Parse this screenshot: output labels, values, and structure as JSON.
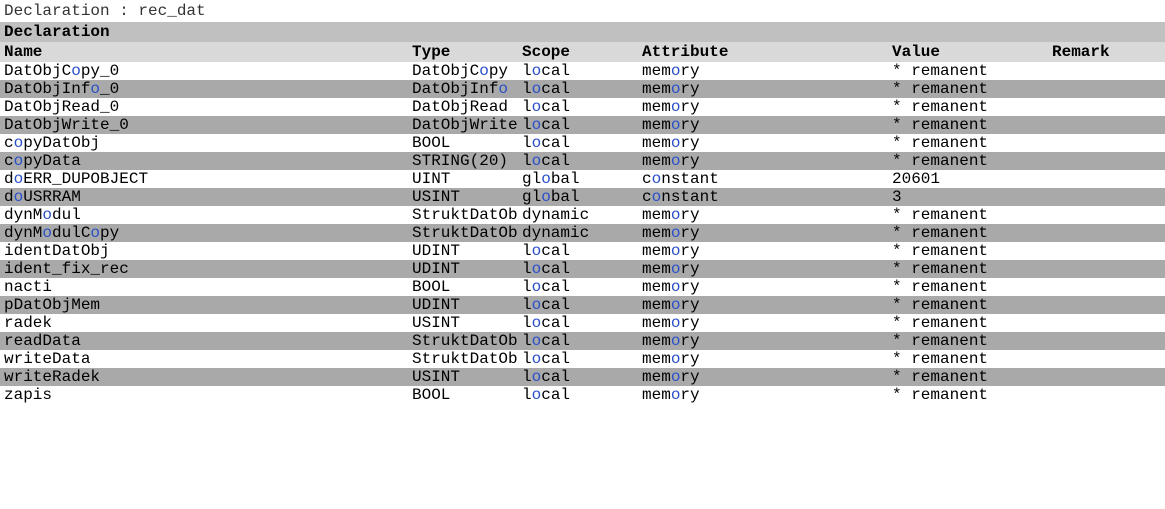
{
  "title_prefix": "Declaration : ",
  "title_name": "rec_dat",
  "section_title": "Declaration",
  "columns": {
    "name": "Name",
    "type": "Type",
    "scope": "Scope",
    "attribute": "Attribute",
    "value": "Value",
    "remark": "Remark"
  },
  "rows": [
    {
      "name": "DatObjCopy_0",
      "type": "DatObjCopy",
      "scope": "local",
      "attribute": "memory",
      "value": "* remanent",
      "remark": ""
    },
    {
      "name": "DatObjInfo_0",
      "type": "DatObjInfo",
      "scope": "local",
      "attribute": "memory",
      "value": "* remanent",
      "remark": ""
    },
    {
      "name": "DatObjRead_0",
      "type": "DatObjRead",
      "scope": "local",
      "attribute": "memory",
      "value": "* remanent",
      "remark": ""
    },
    {
      "name": "DatObjWrite_0",
      "type": "DatObjWrite",
      "scope": "local",
      "attribute": "memory",
      "value": "* remanent",
      "remark": ""
    },
    {
      "name": "copyDatObj",
      "type": "BOOL",
      "scope": "local",
      "attribute": "memory",
      "value": "* remanent",
      "remark": ""
    },
    {
      "name": "copyData",
      "type": "STRING(20)",
      "scope": "local",
      "attribute": "memory",
      "value": "* remanent",
      "remark": ""
    },
    {
      "name": "doERR_DUPOBJECT",
      "type": "UINT",
      "scope": "global",
      "attribute": "constant",
      "value": "20601",
      "remark": ""
    },
    {
      "name": "doUSRRAM",
      "type": "USINT",
      "scope": "global",
      "attribute": "constant",
      "value": "3",
      "remark": ""
    },
    {
      "name": "dynModul",
      "type": "StruktDatObj",
      "scope": "dynamic",
      "attribute": "memory",
      "value": "* remanent",
      "remark": ""
    },
    {
      "name": "dynModulCopy",
      "type": "StruktDatObj",
      "scope": "dynamic",
      "attribute": "memory",
      "value": "* remanent",
      "remark": ""
    },
    {
      "name": "identDatObj",
      "type": "UDINT",
      "scope": "local",
      "attribute": "memory",
      "value": "* remanent",
      "remark": ""
    },
    {
      "name": "ident_fix_rec",
      "type": "UDINT",
      "scope": "local",
      "attribute": "memory",
      "value": "* remanent",
      "remark": ""
    },
    {
      "name": "nacti",
      "type": "BOOL",
      "scope": "local",
      "attribute": "memory",
      "value": "* remanent",
      "remark": ""
    },
    {
      "name": "pDatObjMem",
      "type": "UDINT",
      "scope": "local",
      "attribute": "memory",
      "value": "* remanent",
      "remark": ""
    },
    {
      "name": "radek",
      "type": "USINT",
      "scope": "local",
      "attribute": "memory",
      "value": "* remanent",
      "remark": ""
    },
    {
      "name": "readData",
      "type": "StruktDatObj",
      "scope": "local",
      "attribute": "memory",
      "value": "* remanent",
      "remark": ""
    },
    {
      "name": "writeData",
      "type": "StruktDatObj",
      "scope": "local",
      "attribute": "memory",
      "value": "* remanent",
      "remark": ""
    },
    {
      "name": "writeRadek",
      "type": "USINT",
      "scope": "local",
      "attribute": "memory",
      "value": "* remanent",
      "remark": ""
    },
    {
      "name": "zapis",
      "type": "BOOL",
      "scope": "local",
      "attribute": "memory",
      "value": "* remanent",
      "remark": ""
    }
  ]
}
